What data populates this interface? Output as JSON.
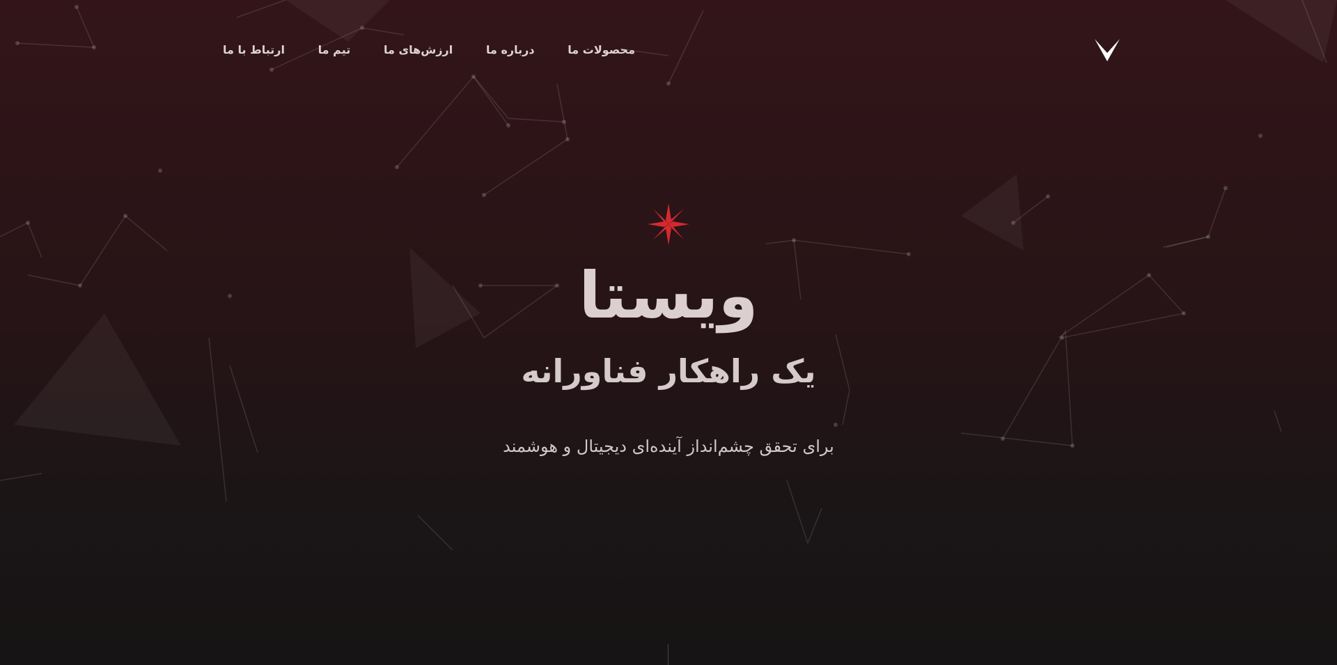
{
  "nav": {
    "items": [
      {
        "label": "محصولات ما"
      },
      {
        "label": "درباره ما"
      },
      {
        "label": "ارزش‌های ما"
      },
      {
        "label": "تیم ما"
      },
      {
        "label": "ارتباط با ما"
      }
    ]
  },
  "logo": {
    "icon": "v-logo-icon"
  },
  "hero": {
    "icon": "red-star-icon",
    "title": "ویستا",
    "subtitle": "یک راهکار فناورانه",
    "tagline": "برای تحقق چشم‌انداز آینده‌ای دیجیتال و هوشمند"
  },
  "theme": {
    "background_top": "#331519",
    "background_bottom": "#161414",
    "accent": "#d42a2f",
    "text": "#dccfd0"
  }
}
